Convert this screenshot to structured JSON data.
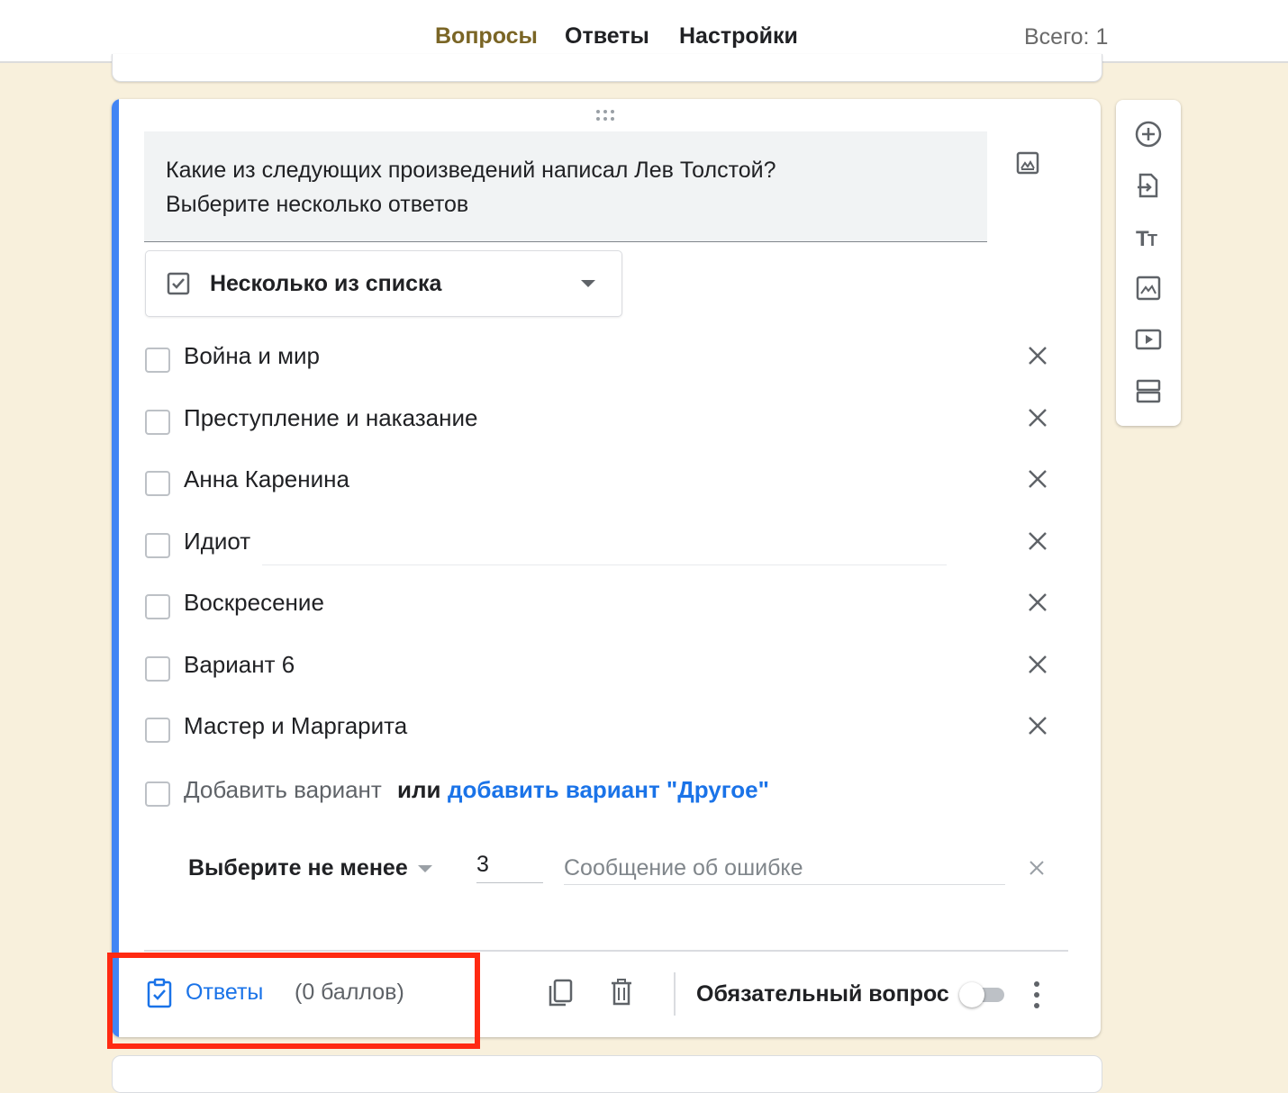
{
  "header": {
    "tabs": [
      {
        "label": "Вопросы",
        "active": true
      },
      {
        "label": "Ответы",
        "active": false
      },
      {
        "label": "Настройки",
        "active": false
      }
    ],
    "total": "Всего: 1"
  },
  "question": {
    "text_line1": "Какие из следующих произведений написал Лев Толстой?",
    "text_line2": "Выберите несколько ответов",
    "image_icon": "image-icon"
  },
  "type_select": {
    "label": "Несколько из списка",
    "icon": "checkbox-icon"
  },
  "options": [
    {
      "label": "Война и мир"
    },
    {
      "label": "Преступление и наказание"
    },
    {
      "label": "Анна Каренина"
    },
    {
      "label": "Идиот"
    },
    {
      "label": "Воскресение"
    },
    {
      "label": "Вариант 6"
    },
    {
      "label": "Мастер и Маргарита"
    }
  ],
  "add_row": {
    "add_option": "Добавить вариант",
    "or": "или",
    "add_other": "добавить вариант \"Другое\""
  },
  "validation": {
    "rule": "Выберите не менее",
    "number": "3",
    "error_placeholder": "Сообщение об ошибке"
  },
  "footer": {
    "answers_label": "Ответы",
    "points": "(0 баллов)",
    "required_label": "Обязательный вопрос",
    "required_on": false
  },
  "toolbar": {
    "icons": [
      "add-question-icon",
      "import-questions-icon",
      "add-title-icon",
      "add-image-icon",
      "add-video-icon",
      "add-section-icon"
    ]
  },
  "colors": {
    "background": "#f8f0dc",
    "accent": "#7a6525",
    "card_accent": "#4285f4",
    "link": "#1a73e8",
    "highlight": "#ff2a12"
  }
}
